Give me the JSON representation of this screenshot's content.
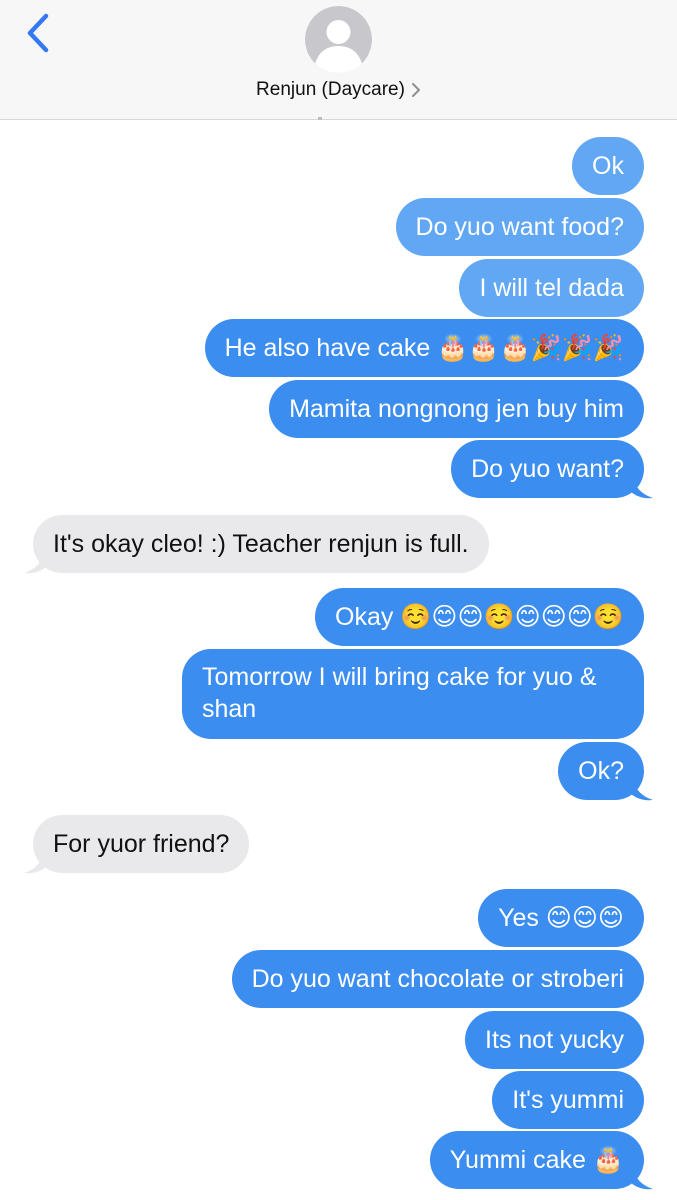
{
  "header": {
    "contact_name": "Renjun (Daycare)",
    "back_icon": "chevron-left-icon",
    "avatar_icon": "person-silhouette-icon",
    "chevron_icon": "chevron-right-icon"
  },
  "colors": {
    "sent_bubble": "#3b8df0",
    "received_bubble": "#e9e9eb",
    "header_bg": "#f7f7f7",
    "accent": "#3478f6"
  },
  "messages": [
    {
      "from": "me",
      "text": "Ok"
    },
    {
      "from": "me",
      "text": "Do yuo want food?"
    },
    {
      "from": "me",
      "text": "I will tel dada"
    },
    {
      "from": "me",
      "text": "He also have cake 🎂🎂🎂🎉🎉🎉"
    },
    {
      "from": "me",
      "text": "Mamita nongnong jen buy him"
    },
    {
      "from": "me",
      "text": "Do yuo want?"
    },
    {
      "from": "them",
      "text": "It's okay cleo! :) Teacher renjun is full."
    },
    {
      "from": "me",
      "text": "Okay ☺️😊😊☺️😊😊😊☺️"
    },
    {
      "from": "me",
      "text": "Tomorrow I will bring cake for yuo & shan"
    },
    {
      "from": "me",
      "text": "Ok?"
    },
    {
      "from": "them",
      "text": "For yuor friend?"
    },
    {
      "from": "me",
      "text": "Yes 😊😊😊"
    },
    {
      "from": "me",
      "text": "Do yuo want chocolate or stroberi"
    },
    {
      "from": "me",
      "text": "Its not yucky"
    },
    {
      "from": "me",
      "text": "It's yummi"
    },
    {
      "from": "me",
      "text": "Yummi cake 🎂"
    }
  ]
}
